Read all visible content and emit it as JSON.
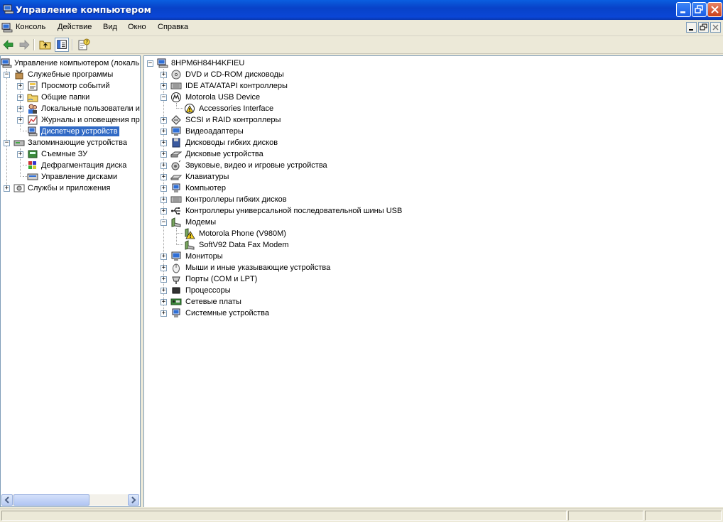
{
  "window": {
    "title": "Управление компьютером"
  },
  "menu": {
    "items": [
      "Консоль",
      "Действие",
      "Вид",
      "Окно",
      "Справка"
    ]
  },
  "toolbar": {
    "buttons": [
      "back-arrow-icon",
      "forward-arrow-icon",
      "up-folder-icon",
      "show-hide-tree-icon",
      "properties-icon"
    ]
  },
  "left_tree": {
    "items": [
      {
        "label": "Управление компьютером (локаль",
        "icon": "computer-management-icon"
      },
      {
        "label": "Служебные программы",
        "icon": "tools-icon"
      },
      {
        "label": "Просмотр событий",
        "icon": "event-viewer-icon"
      },
      {
        "label": "Общие папки",
        "icon": "shared-folder-icon"
      },
      {
        "label": "Локальные пользователи и",
        "icon": "users-icon"
      },
      {
        "label": "Журналы и оповещения пр",
        "icon": "performance-logs-icon"
      },
      {
        "label": "Диспетчер устройств",
        "icon": "device-manager-icon",
        "selected": true
      },
      {
        "label": "Запоминающие устройства",
        "icon": "storage-icon"
      },
      {
        "label": "Съемные ЗУ",
        "icon": "removable-storage-icon"
      },
      {
        "label": "Дефрагментация диска",
        "icon": "defrag-icon"
      },
      {
        "label": "Управление дисками",
        "icon": "disk-management-icon"
      },
      {
        "label": "Службы и приложения",
        "icon": "services-icon"
      }
    ]
  },
  "device_tree": {
    "root": "8HPM6H84H4KFIEU",
    "items": [
      {
        "label": "DVD и CD-ROM дисководы",
        "icon": "cdrom-icon"
      },
      {
        "label": "IDE ATA/ATAPI контроллеры",
        "icon": "ide-controller-icon"
      },
      {
        "label": "Motorola USB Device",
        "icon": "motorola-icon",
        "expanded": true
      },
      {
        "label": "Accessories Interface",
        "icon": "warning-device-icon",
        "child": true
      },
      {
        "label": "SCSI и RAID контроллеры",
        "icon": "scsi-icon"
      },
      {
        "label": "Видеоадаптеры",
        "icon": "display-adapter-icon"
      },
      {
        "label": "Дисководы гибких дисков",
        "icon": "floppy-drive-icon"
      },
      {
        "label": "Дисковые устройства",
        "icon": "disk-drive-icon"
      },
      {
        "label": "Звуковые, видео и игровые устройства",
        "icon": "sound-icon"
      },
      {
        "label": "Клавиатуры",
        "icon": "keyboard-icon"
      },
      {
        "label": "Компьютер",
        "icon": "computer-icon"
      },
      {
        "label": "Контроллеры гибких дисков",
        "icon": "floppy-controller-icon"
      },
      {
        "label": "Контроллеры универсальной последовательной шины USB",
        "icon": "usb-icon"
      },
      {
        "label": "Модемы",
        "icon": "modem-icon",
        "expanded": true
      },
      {
        "label": "Motorola Phone (V980M)",
        "icon": "warning-modem-icon",
        "child": true
      },
      {
        "label": "SoftV92 Data Fax Modem",
        "icon": "modem-icon",
        "child": true
      },
      {
        "label": "Мониторы",
        "icon": "monitor-icon"
      },
      {
        "label": "Мыши и иные указывающие устройства",
        "icon": "mouse-icon"
      },
      {
        "label": "Порты (COM и LPT)",
        "icon": "port-icon"
      },
      {
        "label": "Процессоры",
        "icon": "processor-icon"
      },
      {
        "label": "Сетевые платы",
        "icon": "network-card-icon"
      },
      {
        "label": "Системные устройства",
        "icon": "system-devices-icon"
      }
    ]
  },
  "colors": {
    "titlebar": "#0a46d6",
    "selection": "#316ac5",
    "chrome": "#ece9d8"
  }
}
